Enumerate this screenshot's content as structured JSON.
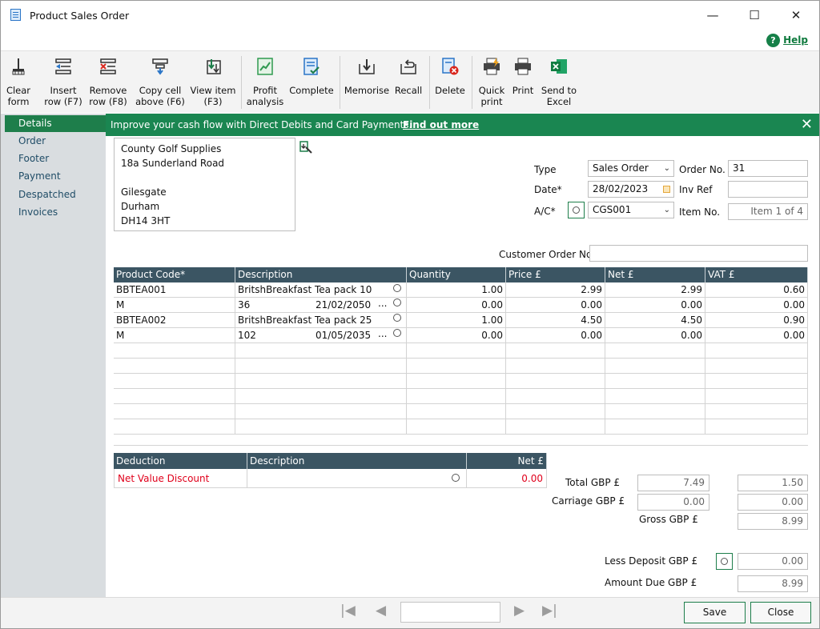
{
  "window": {
    "title": "Product Sales Order",
    "minimize": "—",
    "maximize": "☐",
    "close": "✕"
  },
  "help": {
    "icon": "?",
    "label": "Help"
  },
  "toolbar": {
    "buttons": [
      {
        "label": "Clear\nform",
        "icon": "broom-icon"
      },
      {
        "label": "Insert\nrow (F7)",
        "icon": "insert-row-icon"
      },
      {
        "label": "Remove\nrow (F8)",
        "icon": "remove-row-icon"
      },
      {
        "label": "Copy cell\nabove (F6)",
        "icon": "copy-cell-icon"
      },
      {
        "label": "View item\n(F3)",
        "icon": "view-item-icon"
      },
      {
        "label": "Profit\nanalysis",
        "icon": "profit-chart-icon"
      },
      {
        "label": "Complete",
        "icon": "complete-icon"
      },
      {
        "label": "Memorise",
        "icon": "memorise-icon"
      },
      {
        "label": "Recall",
        "icon": "recall-icon"
      },
      {
        "label": "Delete",
        "icon": "delete-icon"
      },
      {
        "label": "Quick\nprint",
        "icon": "quick-print-icon"
      },
      {
        "label": "Print",
        "icon": "printer-icon"
      },
      {
        "label": "Send to\nExcel",
        "icon": "excel-icon"
      }
    ]
  },
  "sidebar": {
    "items": [
      {
        "label": "Details",
        "active": true
      },
      {
        "label": "Order"
      },
      {
        "label": "Footer"
      },
      {
        "label": "Payment"
      },
      {
        "label": "Despatched"
      },
      {
        "label": "Invoices"
      }
    ]
  },
  "banner": {
    "text": "Improve your cash flow with Direct Debits and Card Payments.",
    "link": "Find out more",
    "close": "✕"
  },
  "address": {
    "lines": [
      "County Golf Supplies",
      "18a Sunderland Road",
      "",
      "Gilesgate",
      "Durham",
      "DH14 3HT"
    ]
  },
  "header_fields": {
    "type_label": "Type",
    "type_value": "Sales Order",
    "order_no_label": "Order No.",
    "order_no_value": "31",
    "date_label": "Date*",
    "date_value": "28/02/2023",
    "inv_ref_label": "Inv Ref",
    "inv_ref_value": "",
    "ac_label": "A/C*",
    "ac_value": "CGS001",
    "item_no_label": "Item No.",
    "item_no_value": "Item 1 of 4",
    "customer_order_label": "Customer Order No.",
    "customer_order_value": ""
  },
  "items_grid": {
    "columns": [
      "Product Code*",
      "Description",
      "Quantity",
      "Price £",
      "Net £",
      "VAT £"
    ],
    "rows": [
      {
        "code": "BBTEA001",
        "desc": "BritshBreakfast  Tea pack 10",
        "desc2": "",
        "more": "",
        "qty": "1.00",
        "price": "2.99",
        "net": "2.99",
        "vat": "0.60"
      },
      {
        "code": "M",
        "desc": "36",
        "desc2": "21/02/2050",
        "more": "...",
        "qty": "0.00",
        "price": "0.00",
        "net": "0.00",
        "vat": "0.00"
      },
      {
        "code": "BBTEA002",
        "desc": "BritshBreakfast  Tea pack 25",
        "desc2": "",
        "more": "",
        "qty": "1.00",
        "price": "4.50",
        "net": "4.50",
        "vat": "0.90"
      },
      {
        "code": "M",
        "desc": "102",
        "desc2": "01/05/2035",
        "more": "...",
        "qty": "0.00",
        "price": "0.00",
        "net": "0.00",
        "vat": "0.00"
      }
    ],
    "empty_rows": 6
  },
  "deduction_grid": {
    "columns": [
      "Deduction",
      "Description",
      "Net £"
    ],
    "row": {
      "deduction": "Net Value Discount",
      "description": "",
      "net": "0.00"
    }
  },
  "totals": {
    "total_label": "Total GBP £",
    "total_net": "7.49",
    "total_vat": "1.50",
    "carriage_label": "Carriage GBP £",
    "carriage_net": "0.00",
    "carriage_vat": "0.00",
    "gross_label": "Gross GBP £",
    "gross_value": "8.99",
    "deposit_label": "Less Deposit GBP £",
    "deposit_value": "0.00",
    "amount_due_label": "Amount Due GBP £",
    "amount_due_value": "8.99"
  },
  "footer": {
    "first": "|◀",
    "prev": "◀",
    "next": "▶",
    "last": "▶|",
    "record_value": "",
    "save": "Save",
    "close": "Close"
  },
  "colors": {
    "accent_green": "#1e7e4b",
    "grid_header": "#3b5563",
    "sidebar_bg": "#d9dde0",
    "discount_red": "#e0001b"
  }
}
